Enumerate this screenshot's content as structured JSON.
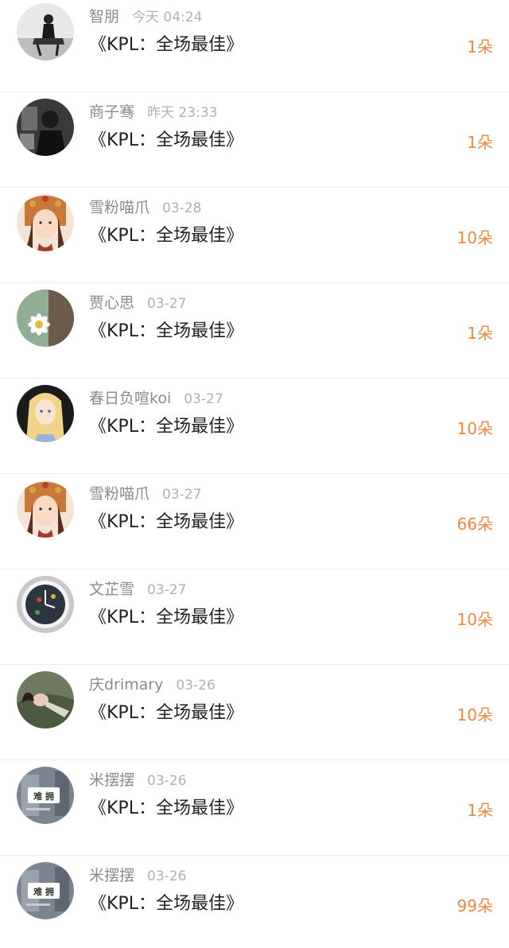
{
  "colors": {
    "name": "#8a8a8a",
    "time": "#b0b0b0",
    "title": "#222222",
    "count": "#f0883e",
    "divider": "#ededed"
  },
  "rows": [
    {
      "name": "智朋",
      "time": "今天 04:24",
      "title": "《KPL：全场最佳》",
      "count": "1朵",
      "avatar": "photo-person-sitting-bw"
    },
    {
      "name": "商子骞",
      "time": "昨天 23:33",
      "title": "《KPL：全场最佳》",
      "count": "1朵",
      "avatar": "photo-person-dark-bw"
    },
    {
      "name": "雪粉喵爪",
      "time": "03-28",
      "title": "《KPL：全场最佳》",
      "count": "10朵",
      "avatar": "illustration-girl-headdress"
    },
    {
      "name": "贾心思",
      "time": "03-27",
      "title": "《KPL：全场最佳》",
      "count": "1朵",
      "avatar": "photo-white-flower"
    },
    {
      "name": "春日负喧koi",
      "time": "03-27",
      "title": "《KPL：全场最佳》",
      "count": "10朵",
      "avatar": "illustration-blonde-girl"
    },
    {
      "name": "雪粉喵爪",
      "time": "03-27",
      "title": "《KPL：全场最佳》",
      "count": "66朵",
      "avatar": "illustration-girl-headdress"
    },
    {
      "name": "文芷雪",
      "time": "03-27",
      "title": "《KPL：全场最佳》",
      "count": "10朵",
      "avatar": "photo-wall-clock"
    },
    {
      "name": "庆drimary",
      "time": "03-26",
      "title": "《KPL：全场最佳》",
      "count": "10朵",
      "avatar": "photo-girl-lying"
    },
    {
      "name": "米摆摆",
      "time": "03-26",
      "title": "《KPL：全场最佳》",
      "count": "1朵",
      "avatar": "photo-sign-blurred"
    },
    {
      "name": "米摆摆",
      "time": "03-26",
      "title": "《KPL：全场最佳》",
      "count": "99朵",
      "avatar": "photo-sign-blurred"
    }
  ]
}
